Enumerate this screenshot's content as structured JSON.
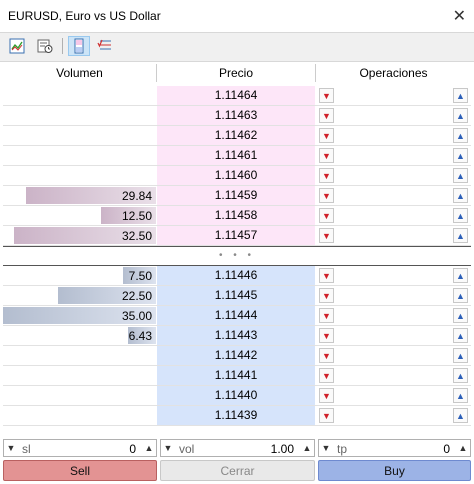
{
  "window": {
    "title": "EURUSD, Euro vs US Dollar",
    "close_glyph": "✕"
  },
  "toolbar": {
    "icons": [
      "chart-icon",
      "history-clock-icon",
      "depth-of-market-icon",
      "trade-settings-icon"
    ]
  },
  "headers": {
    "volume": "Volumen",
    "price": "Precio",
    "operations": "Operaciones"
  },
  "ask_rows": [
    {
      "volume": "",
      "price": "1.11464"
    },
    {
      "volume": "",
      "price": "1.11463"
    },
    {
      "volume": "",
      "price": "1.11462"
    },
    {
      "volume": "",
      "price": "1.11461"
    },
    {
      "volume": "",
      "price": "1.11460"
    },
    {
      "volume": "29.84",
      "price": "1.11459"
    },
    {
      "volume": "12.50",
      "price": "1.11458"
    },
    {
      "volume": "32.50",
      "price": "1.11457"
    }
  ],
  "spread_indicator": "• • •",
  "bid_rows": [
    {
      "volume": "7.50",
      "price": "1.11446"
    },
    {
      "volume": "22.50",
      "price": "1.11445"
    },
    {
      "volume": "35.00",
      "price": "1.11444"
    },
    {
      "volume": "6.43",
      "price": "1.11443"
    },
    {
      "volume": "",
      "price": "1.11442"
    },
    {
      "volume": "",
      "price": "1.11441"
    },
    {
      "volume": "",
      "price": "1.11440"
    },
    {
      "volume": "",
      "price": "1.11439"
    }
  ],
  "inputs": {
    "sl": {
      "label": "sl",
      "value": "0"
    },
    "vol": {
      "label": "vol",
      "value": "1.00"
    },
    "tp": {
      "label": "tp",
      "value": "0"
    }
  },
  "buttons": {
    "sell": "Sell",
    "close": "Cerrar",
    "buy": "Buy"
  },
  "colors": {
    "ask_bg": "#fde6f8",
    "bid_bg": "#d6e4fb",
    "sell": "#e39393",
    "buy": "#9cb3e6"
  }
}
